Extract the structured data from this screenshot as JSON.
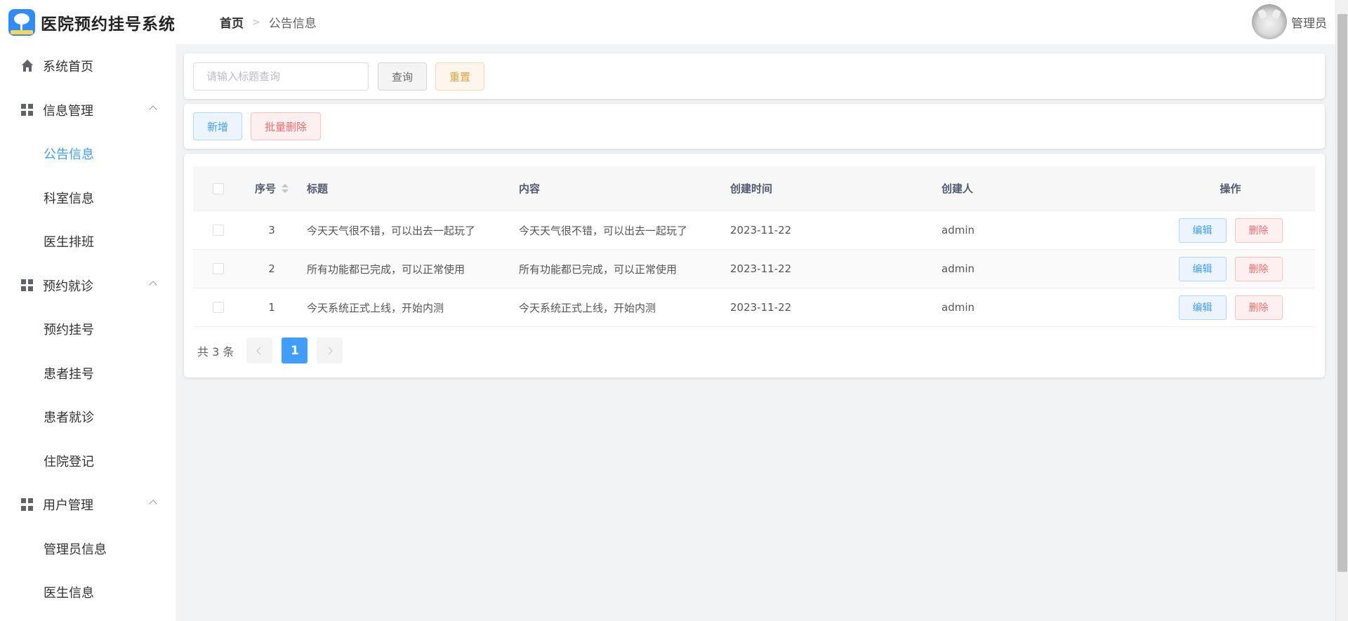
{
  "header": {
    "app_title": "医院预约挂号系统",
    "breadcrumb": {
      "home": "首页",
      "separator": ">",
      "current": "公告信息"
    },
    "user_name": "管理员"
  },
  "sidebar": {
    "items": [
      {
        "label": "系统首页",
        "type": "top",
        "icon": "home-icon"
      },
      {
        "label": "信息管理",
        "type": "group",
        "icon": "grid-icon",
        "expanded": true
      },
      {
        "label": "公告信息",
        "type": "sub",
        "active": true
      },
      {
        "label": "科室信息",
        "type": "sub"
      },
      {
        "label": "医生排班",
        "type": "sub"
      },
      {
        "label": "预约就诊",
        "type": "group",
        "icon": "grid-icon",
        "expanded": true
      },
      {
        "label": "预约挂号",
        "type": "sub"
      },
      {
        "label": "患者挂号",
        "type": "sub"
      },
      {
        "label": "患者就诊",
        "type": "sub"
      },
      {
        "label": "住院登记",
        "type": "sub"
      },
      {
        "label": "用户管理",
        "type": "group",
        "icon": "grid-icon",
        "expanded": true
      },
      {
        "label": "管理员信息",
        "type": "sub"
      },
      {
        "label": "医生信息",
        "type": "sub"
      }
    ]
  },
  "search": {
    "placeholder": "请输入标题查询",
    "value": "",
    "query_label": "查询",
    "reset_label": "重置"
  },
  "actions": {
    "add_label": "新增",
    "batch_delete_label": "批量删除"
  },
  "table": {
    "columns": {
      "index": "序号",
      "title": "标题",
      "content": "内容",
      "created_time": "创建时间",
      "creator": "创建人",
      "ops": "操作"
    },
    "rows": [
      {
        "index": "3",
        "title": "今天天气很不错，可以出去一起玩了",
        "content": "今天天气很不错，可以出去一起玩了",
        "created_time": "2023-11-22",
        "creator": "admin",
        "edit": "编辑",
        "delete": "删除"
      },
      {
        "index": "2",
        "title": "所有功能都已完成，可以正常使用",
        "content": "所有功能都已完成，可以正常使用",
        "created_time": "2023-11-22",
        "creator": "admin",
        "edit": "编辑",
        "delete": "删除"
      },
      {
        "index": "1",
        "title": "今天系统正式上线，开始内测",
        "content": "今天系统正式上线，开始内测",
        "created_time": "2023-11-22",
        "creator": "admin",
        "edit": "编辑",
        "delete": "删除"
      }
    ]
  },
  "pagination": {
    "total_text": "共 3 条",
    "current_page": "1"
  },
  "colors": {
    "primary": "#409eff",
    "danger": "#f56c6c",
    "warning": "#e6a23c"
  }
}
